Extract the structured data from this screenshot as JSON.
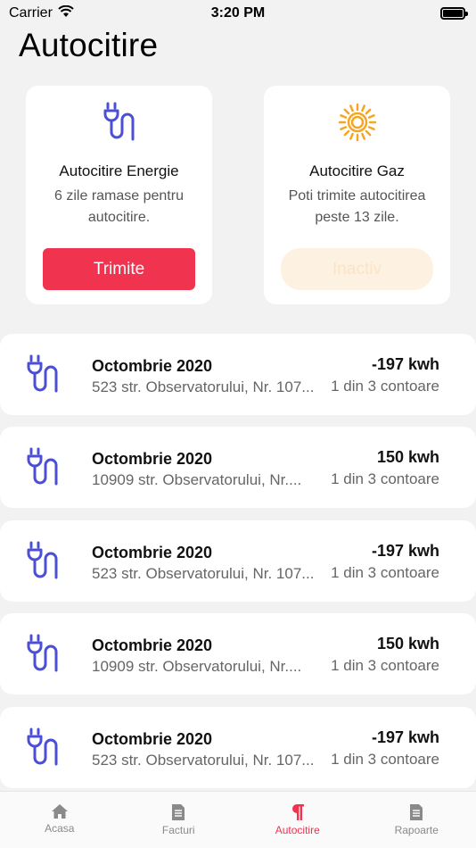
{
  "status_bar": {
    "carrier": "Carrier",
    "time": "3:20 PM"
  },
  "page": {
    "title": "Autocitire"
  },
  "cards": {
    "energy": {
      "icon": "plug-icon",
      "title": "Autocitire Energie",
      "desc_line1": "6 zile ramase pentru",
      "desc_line2": "autocitire.",
      "button": "Trimite"
    },
    "gas": {
      "icon": "sun-icon",
      "title": "Autocitire Gaz",
      "desc_line1": "Poti trimite autocitirea",
      "desc_line2": "peste 13 zile.",
      "button": "Inactiv"
    }
  },
  "readings": [
    {
      "title": "Octombrie 2020",
      "address": "523 str. Observatorului, Nr. 107...",
      "value": "-197 kwh",
      "meters": "1 din 3 contoare"
    },
    {
      "title": "Octombrie 2020",
      "address": "10909 str. Observatorului, Nr....",
      "value": "150 kwh",
      "meters": "1 din 3 contoare"
    },
    {
      "title": "Octombrie 2020",
      "address": "523 str. Observatorului, Nr. 107...",
      "value": "-197 kwh",
      "meters": "1 din 3 contoare"
    },
    {
      "title": "Octombrie 2020",
      "address": "10909 str. Observatorului, Nr....",
      "value": "150 kwh",
      "meters": "1 din 3 contoare"
    },
    {
      "title": "Octombrie 2020",
      "address": "523 str. Observatorului, Nr. 107...",
      "value": "-197 kwh",
      "meters": "1 din 3 contoare"
    }
  ],
  "tabs": [
    {
      "label": "Acasa",
      "icon": "home-icon",
      "active": false
    },
    {
      "label": "Facturi",
      "icon": "document-icon",
      "active": false
    },
    {
      "label": "Autocitire",
      "icon": "pilcrow-icon",
      "active": true
    },
    {
      "label": "Rapoarte",
      "icon": "document-icon",
      "active": false
    }
  ],
  "colors": {
    "accent": "#f0344f",
    "icon_blue": "#4a4fd6",
    "sun_orange": "#f5a623",
    "inactive_bg": "#fdf1e1"
  }
}
